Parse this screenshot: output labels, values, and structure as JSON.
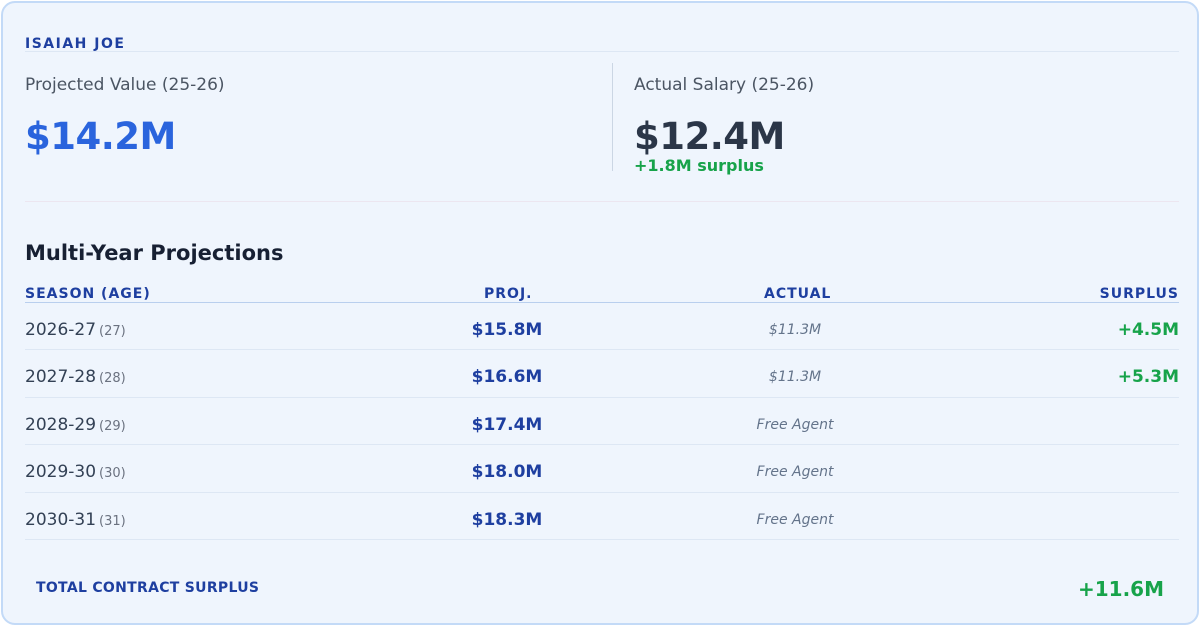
{
  "player": {
    "name": "ISAIAH JOE"
  },
  "projected": {
    "label": "Projected Value (25-26)",
    "value": "$14.2M"
  },
  "actual": {
    "label": "Actual Salary (25-26)",
    "value": "$12.4M",
    "note": "+1.8M surplus"
  },
  "projections": {
    "title": "Multi-Year Projections",
    "columns": {
      "season": "SEASON (AGE)",
      "proj": "PROJ.",
      "actual": "ACTUAL",
      "surplus": "SURPLUS"
    },
    "rows": [
      {
        "season": "2026-27",
        "age": "(27)",
        "proj": "$15.8M",
        "actual": "$11.3M",
        "surplus": "+4.5M"
      },
      {
        "season": "2027-28",
        "age": "(28)",
        "proj": "$16.6M",
        "actual": "$11.3M",
        "surplus": "+5.3M"
      },
      {
        "season": "2028-29",
        "age": "(29)",
        "proj": "$17.4M",
        "actual": "Free Agent",
        "surplus": ""
      },
      {
        "season": "2029-30",
        "age": "(30)",
        "proj": "$18.0M",
        "actual": "Free Agent",
        "surplus": ""
      },
      {
        "season": "2030-31",
        "age": "(31)",
        "proj": "$18.3M",
        "actual": "Free Agent",
        "surplus": ""
      }
    ]
  },
  "total": {
    "label": "TOTAL CONTRACT SURPLUS",
    "value": "+11.6M"
  },
  "colors": {
    "accent_blue": "#2a64dd",
    "header_blue": "#1e3fa0",
    "surplus_green": "#17a34a",
    "card_bg": "#eff5fd"
  }
}
